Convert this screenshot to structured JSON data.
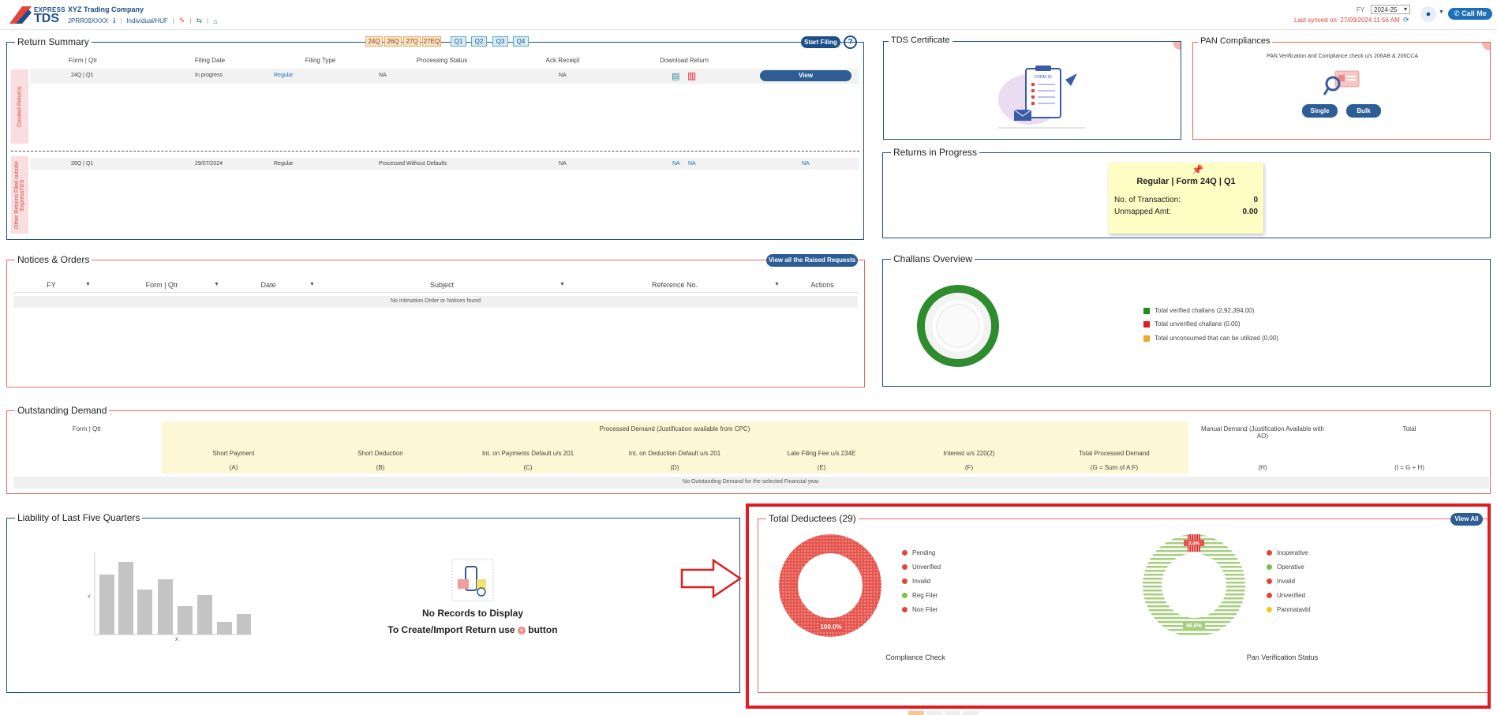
{
  "header": {
    "brand_express": "EXPRESS",
    "brand_tds": "TDS",
    "company": "XYZ Trading Company",
    "pan": "JPRR09XXXX",
    "entity_type": "Individual/HUF",
    "fy_label": "FY",
    "fy_value": "2024-25",
    "last_synced": "Last synced on: 27/09/2024 11:56 AM",
    "call_me": "Call Me"
  },
  "return_summary": {
    "title": "Return Summary",
    "form_tags": [
      "24Q",
      "26Q",
      "27Q",
      "27EQ"
    ],
    "quarter_tags": [
      "Q1",
      "Q2",
      "Q3",
      "Q4"
    ],
    "start_filing": "Start Filing",
    "help": "?",
    "columns": [
      "Form | Qtr",
      "Filing Date",
      "Filing Type",
      "Processing Status",
      "Ack Receipt",
      "Download Return"
    ],
    "created_label": "Created Returns",
    "other_label": "Other Returns Filed outside ExpressTDS",
    "created_row": {
      "form_qtr": "24Q | Q1",
      "filing_date": "In progress",
      "filing_type": "Regular",
      "status": "NA",
      "ack": "NA",
      "action": "View"
    },
    "other_row": {
      "form_qtr": "26Q | Q1",
      "filing_date": "29/07/2024",
      "filing_type": "Regular",
      "status": "Processed Without Defaults",
      "ack": "NA",
      "dl1": "NA",
      "dl2": "NA",
      "dl3": "NA"
    }
  },
  "tds_certificate": {
    "title": "TDS Certificate",
    "form_label": "FORM 16"
  },
  "pan_compliances": {
    "title": "PAN Compliances",
    "description": "PAN Verification and Compliance check u/s 206AB & 206CCA",
    "single": "Single",
    "bulk": "Bulk"
  },
  "returns_in_progress": {
    "title": "Returns in Progress",
    "card_title": "Regular | Form 24Q | Q1",
    "txn_label": "No. of Transaction:",
    "txn_value": "0",
    "unmapped_label": "Unmapped Amt:",
    "unmapped_value": "0.00"
  },
  "notices": {
    "title": "Notices & Orders",
    "view_all": "View all the Raised Requests",
    "columns": [
      "FY",
      "Form | Qtr",
      "Date",
      "Subject",
      "Reference No.",
      "Actions"
    ],
    "empty": "No Intimation Order or Notices found"
  },
  "challans": {
    "title": "Challans Overview",
    "legend": [
      {
        "label": "Total verified challans (2,92,394.00)",
        "color": "#1e8c1e"
      },
      {
        "label": "Total unverified challans (0.00)",
        "color": "#e11b22"
      },
      {
        "label": "Total unconsumed that can be utilized (0.00)",
        "color": "#f5a623"
      }
    ]
  },
  "outstanding": {
    "title": "Outstanding Demand",
    "form_qtr": "Form | Qtr",
    "processed_header": "Processed Demand (Justification available from CPC)",
    "manual_header": "Manual Demand (Justification Available with AO)",
    "total_header": "Total",
    "sub_columns": [
      {
        "label": "Short Payment",
        "code": "(A)"
      },
      {
        "label": "Short Deduction",
        "code": "(B)"
      },
      {
        "label": "Int. on Payments Default u/s 201",
        "code": "(C)"
      },
      {
        "label": "Int. on Deduction Default u/s 201",
        "code": "(D)"
      },
      {
        "label": "Late Filing Fee u/s 234E",
        "code": "(E)"
      },
      {
        "label": "Interest u/s 220(2)",
        "code": "(F)"
      },
      {
        "label": "Total Processed Demand",
        "code": "(G = Sum of A:F)"
      }
    ],
    "manual_code": "(H)",
    "total_code": "(I = G + H)",
    "empty": "No Outstanding Demand for the selected Financial year."
  },
  "liability": {
    "title": "Liability of Last Five Quarters",
    "y_axis": "Y",
    "x_axis": "X",
    "no_records": "No Records to Display",
    "create_prefix": "To Create/Import Return use",
    "create_suffix": "button"
  },
  "deductees": {
    "title": "Total Deductees (29)",
    "view_all": "View All",
    "compliance_caption": "Compliance Check",
    "compliance_pct": "100.0%",
    "compliance_legend": [
      {
        "label": "Pending",
        "color": "#e0463b"
      },
      {
        "label": "Unverified",
        "color": "#e0463b"
      },
      {
        "label": "Invalid",
        "color": "#e0463b"
      },
      {
        "label": "Reg Filer",
        "color": "#7cbf4a"
      },
      {
        "label": "Non Filer",
        "color": "#e0463b"
      }
    ],
    "pan_caption": "Pan Verification Status",
    "pan_top_pct": "3.4%",
    "pan_bottom_pct": "96.6%",
    "pan_legend": [
      {
        "label": "Inoperative",
        "color": "#e0463b"
      },
      {
        "label": "Operative",
        "color": "#7cbf4a"
      },
      {
        "label": "Invalid",
        "color": "#e0463b"
      },
      {
        "label": "Unverified",
        "color": "#e0463b"
      },
      {
        "label": "Panmatavbl",
        "color": "#f5c518"
      }
    ]
  }
}
